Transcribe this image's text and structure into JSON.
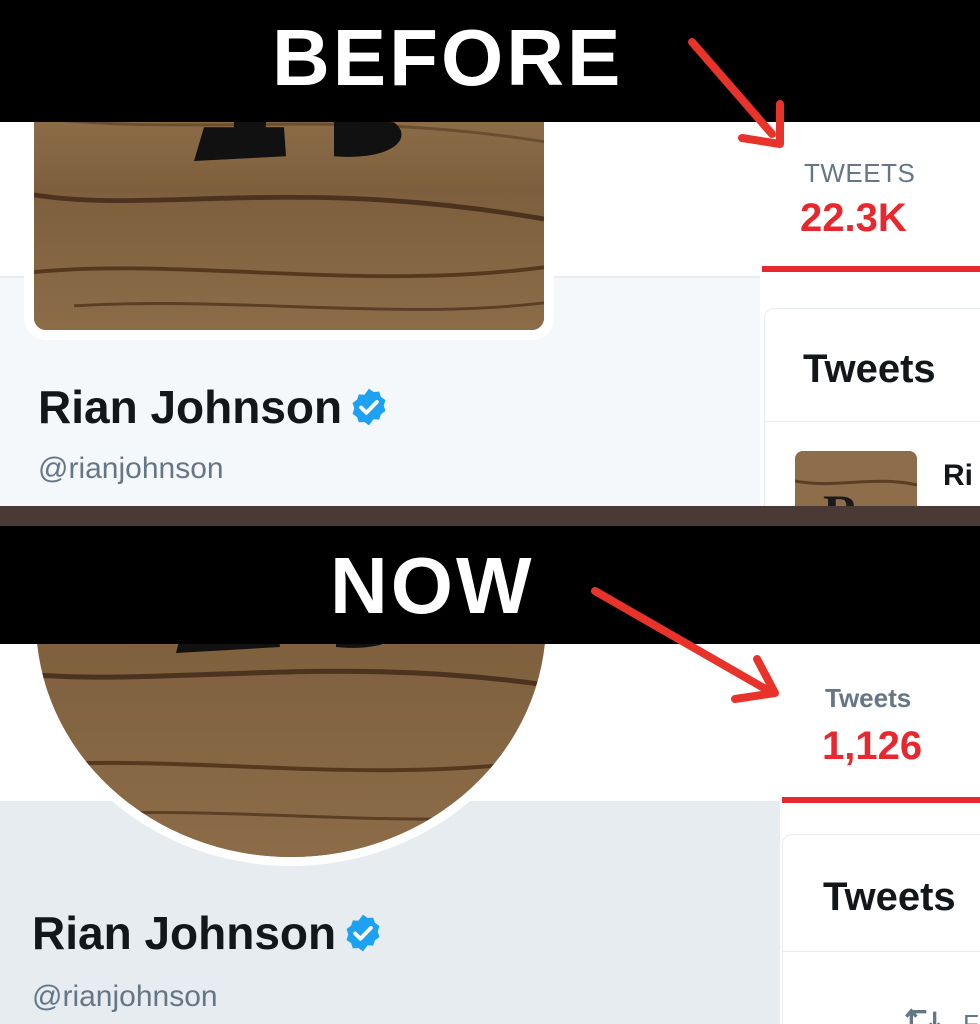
{
  "colors": {
    "banner_bg": "#000000",
    "banner_text": "#ffffff",
    "accent_red": "#e8282e",
    "arrow_red": "#e8332a",
    "verified_blue": "#1da1f2",
    "divider": "#4a3a36"
  },
  "before": {
    "banner_label": "BEFORE",
    "profile": {
      "name": "Rian Johnson",
      "handle": "@rianjohnson",
      "verified_icon": "verified-badge-icon"
    },
    "stat": {
      "label": "TWEETS",
      "value": "22.3K"
    },
    "timeline": {
      "title": "Tweets",
      "preview_name": "Ri"
    }
  },
  "now": {
    "banner_label": "NOW",
    "profile": {
      "name": "Rian Johnson",
      "handle": "@rianjohnson",
      "verified_icon": "verified-badge-icon"
    },
    "stat": {
      "label": "Tweets",
      "value": "1,126"
    },
    "timeline": {
      "title": "Tweets",
      "retweet_icon": "retweet-icon",
      "retweet_text": "F"
    }
  }
}
